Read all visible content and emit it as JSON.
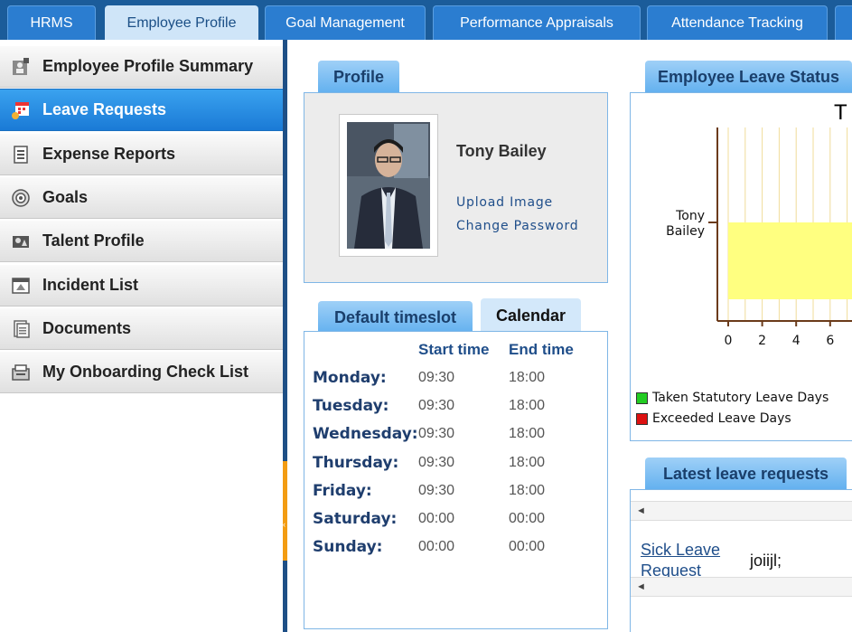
{
  "top_tabs": [
    {
      "label": "HRMS",
      "active": false
    },
    {
      "label": "Employee Profile",
      "active": true
    },
    {
      "label": "Goal Management",
      "active": false
    },
    {
      "label": "Performance Appraisals",
      "active": false
    },
    {
      "label": "Attendance Tracking",
      "active": false
    }
  ],
  "sidebar": {
    "items": [
      {
        "label": "Employee Profile Summary",
        "icon": "profile-summary-icon",
        "active": false
      },
      {
        "label": "Leave Requests",
        "icon": "leave-requests-icon",
        "active": true
      },
      {
        "label": "Expense Reports",
        "icon": "expense-reports-icon",
        "active": false
      },
      {
        "label": "Goals",
        "icon": "goals-icon",
        "active": false
      },
      {
        "label": "Talent Profile",
        "icon": "talent-profile-icon",
        "active": false
      },
      {
        "label": "Incident List",
        "icon": "incident-list-icon",
        "active": false
      },
      {
        "label": "Documents",
        "icon": "documents-icon",
        "active": false
      },
      {
        "label": "My Onboarding Check List",
        "icon": "onboarding-checklist-icon",
        "active": false
      }
    ]
  },
  "profile": {
    "tab_label": "Profile",
    "name": "Tony Bailey",
    "upload_image": "Upload Image",
    "change_password": "Change Password"
  },
  "timeslot": {
    "tab_default": "Default timeslot",
    "tab_calendar": "Calendar",
    "header_start": "Start time",
    "header_end": "End time",
    "rows": [
      {
        "day": "Monday:",
        "start": "09:30",
        "end": "18:00"
      },
      {
        "day": "Tuesday:",
        "start": "09:30",
        "end": "18:00"
      },
      {
        "day": "Wednesday:",
        "start": "09:30",
        "end": "18:00"
      },
      {
        "day": "Thursday:",
        "start": "09:30",
        "end": "18:00"
      },
      {
        "day": "Friday:",
        "start": "09:30",
        "end": "18:00"
      },
      {
        "day": "Saturday:",
        "start": "00:00",
        "end": "00:00"
      },
      {
        "day": "Sunday:",
        "start": "00:00",
        "end": "00:00"
      }
    ]
  },
  "leave_status": {
    "tab_label": "Employee Leave Status",
    "title_fragment": "T"
  },
  "chart_data": {
    "type": "bar",
    "orientation": "horizontal",
    "categories": [
      "Tony Bailey"
    ],
    "category_lines": [
      [
        "Tony",
        "Bailey"
      ]
    ],
    "series": [
      {
        "name": "Taken Statutory Leave Days",
        "color": "#22cc22",
        "values": [
          0
        ]
      },
      {
        "name": "Exceeded Leave Days",
        "color": "#dd1111",
        "values": [
          0
        ]
      }
    ],
    "visible_bar_color": "#ffff80",
    "visible_bar_min_value": 0,
    "x_ticks": [
      0,
      2,
      4,
      6
    ],
    "xlim_visible": [
      0,
      7
    ],
    "grid": true,
    "legend_position": "bottom-left"
  },
  "latest_requests": {
    "tab_label": "Latest leave requests",
    "link_line1": "Sick Leave",
    "link_line2": "Request",
    "reason": "joiijl;",
    "scroll_arrow": "◄"
  },
  "colors": {
    "topbar": "#1b5c9a",
    "accent_blue": "#2b7dd0",
    "active_sidebar": "#1a7ad6",
    "splitter": "#f39c12"
  }
}
